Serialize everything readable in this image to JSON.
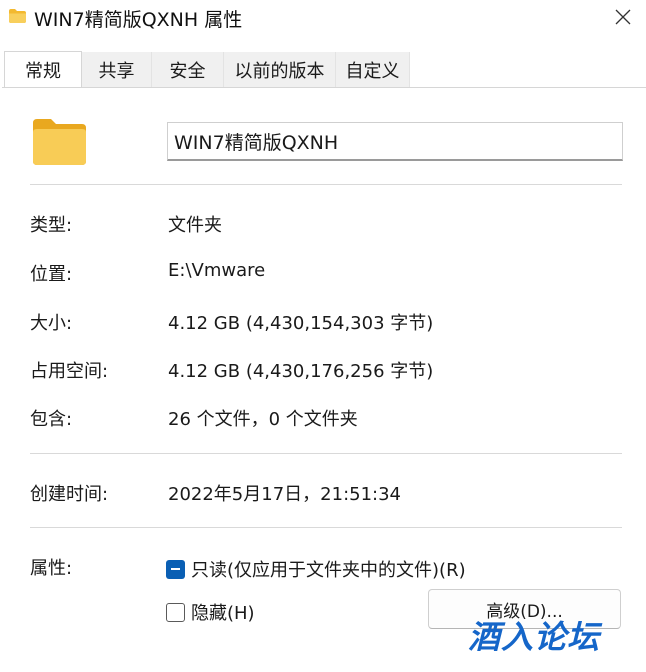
{
  "window": {
    "title": "WIN7精简版QXNH 属性"
  },
  "tabs": [
    {
      "label": "常规",
      "active": true
    },
    {
      "label": "共享",
      "active": false
    },
    {
      "label": "安全",
      "active": false
    },
    {
      "label": "以前的版本",
      "active": false
    },
    {
      "label": "自定义",
      "active": false
    }
  ],
  "general": {
    "folder_name": "WIN7精简版QXNH",
    "type_label": "类型:",
    "type_value": "文件夹",
    "location_label": "位置:",
    "location_value": "E:\\Vmware",
    "size_label": "大小:",
    "size_value": "4.12 GB (4,430,154,303 字节)",
    "size_on_disk_label": "占用空间:",
    "size_on_disk_value": "4.12 GB (4,430,176,256 字节)",
    "contains_label": "包含:",
    "contains_value": "26 个文件，0 个文件夹",
    "created_label": "创建时间:",
    "created_value": "2022年5月17日，21:51:34",
    "attributes_label": "属性:",
    "readonly_label": "只读(仅应用于文件夹中的文件)(R)",
    "readonly_state": "indeterminate",
    "hidden_label": "隐藏(H)",
    "hidden_checked": false,
    "advanced_button": "高级(D)..."
  },
  "watermark": "酒入论坛",
  "colors": {
    "accent": "#0a5fb4",
    "folder": "#f8c94a",
    "watermark": "#1566c9"
  }
}
